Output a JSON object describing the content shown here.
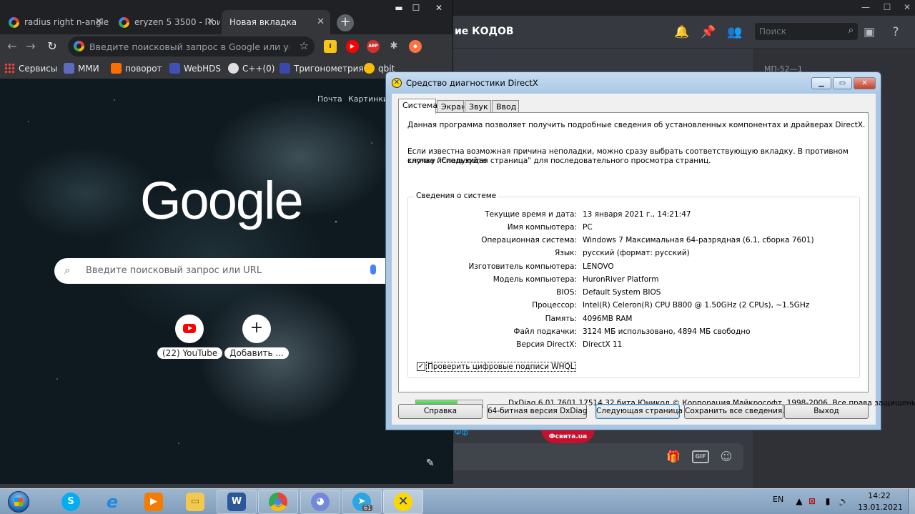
{
  "discord": {
    "channel_title": "ие КОДОВ",
    "search_placeholder": "Поиск",
    "member_group": "МП-52—1",
    "embed_text": "Фсвита.ua",
    "link_text": "Фф",
    "window_controls": [
      "—",
      "☐",
      "✕"
    ],
    "header_icons": [
      "bell-icon",
      "pin-icon",
      "members-icon",
      "inbox-icon",
      "help-icon"
    ],
    "input_icons": [
      "gift-icon",
      "gif-icon",
      "emoji-icon"
    ]
  },
  "chrome": {
    "tabs": [
      {
        "title": "radius right n-angle...",
        "active": false
      },
      {
        "title": "eryzen 5 3500 - Пои...",
        "active": false
      },
      {
        "title": "Новая вкладка",
        "active": true
      }
    ],
    "omnibox_placeholder": "Введите поисковый запрос в Google или ука...",
    "bookmarks": [
      {
        "label": "Сервисы",
        "color": "#ea4335"
      },
      {
        "label": "ММИ",
        "color": "#5c6bc0"
      },
      {
        "label": "поворот",
        "color": "#ff6d00"
      },
      {
        "label": "WebHDS",
        "color": "#3f51b5"
      },
      {
        "label": "C++(0)",
        "color": "#e0e0e0"
      },
      {
        "label": "Тригонометрия",
        "color": "#3949ab"
      },
      {
        "label": "qbit",
        "color": "#fbbc05"
      }
    ],
    "extensions": [
      {
        "name": "l-extension",
        "text": "l",
        "color": "#f5c518"
      },
      {
        "name": "youtube-extension",
        "text": "▶",
        "color": "#ff0000"
      },
      {
        "name": "adblock-extension",
        "text": "ABP",
        "color": "#d32f2f"
      },
      {
        "name": "puzzle-extension",
        "text": "✱",
        "color": "#5f6368"
      },
      {
        "name": "fox-extension",
        "text": "◆",
        "color": "#ff7043"
      }
    ],
    "top_links": [
      "Почта",
      "Картинки"
    ],
    "logo_text": "Google",
    "search_placeholder": "Введите поисковый запрос или URL",
    "shortcuts": [
      {
        "label": "(22) YouTube",
        "icon": "youtube-icon"
      },
      {
        "label": "Добавить ...",
        "icon": "plus-icon"
      }
    ]
  },
  "dxdiag": {
    "window_title": "Средство диагностики DirectX",
    "tabs": [
      "Система",
      "Экран",
      "Звук",
      "Ввод"
    ],
    "intro_1": "Данная программа позволяет получить подробные сведения об установленных компонентах и драйверах DirectX.",
    "intro_2a": "Если известна возможная причина неполадки, можно сразу выбрать соответствующую вкладку. В противном случае используйте",
    "intro_2b": "кнопку \"Следующая страница\" для последовательного просмотра страниц.",
    "group_title": "Сведения о системе",
    "rows": [
      {
        "label": "Текущие время и дата:",
        "value": "13 января 2021 г., 14:21:47"
      },
      {
        "label": "Имя компьютера:",
        "value": "PC"
      },
      {
        "label": "Операционная система:",
        "value": "Windows 7 Максимальная 64-разрядная (6.1, сборка 7601)"
      },
      {
        "label": "Язык:",
        "value": "русский (формат: русский)"
      },
      {
        "label": "Изготовитель компьютера:",
        "value": "LENOVO"
      },
      {
        "label": "Модель компьютера:",
        "value": "HuronRiver Platform"
      },
      {
        "label": "BIOS:",
        "value": "Default System BIOS"
      },
      {
        "label": "Процессор:",
        "value": "Intel(R) Celeron(R) CPU B800 @ 1.50GHz (2 CPUs), ~1.5GHz"
      },
      {
        "label": "Память:",
        "value": "4096MB RAM"
      },
      {
        "label": "Файл подкачки:",
        "value": "3124 МБ использовано, 4894 МБ свободно"
      },
      {
        "label": "Версия DirectX:",
        "value": "DirectX 11"
      }
    ],
    "whql_label": "Проверить цифровые подписи WHQL",
    "whql_checked": true,
    "progress_fraction": 0.62,
    "copyright": "DxDiag 6.01.7601.17514 32 бита Юникод  © Корпорация Майкрософт, 1998-2006.  Все права защищены.",
    "buttons": {
      "help": "Справка",
      "dxdiag64": "64-битная версия DxDiag",
      "next": "Следующая страница",
      "save": "Сохранить все сведения...",
      "exit": "Выход"
    }
  },
  "taskbar": {
    "apps": [
      {
        "name": "skype-taskbar",
        "text": "S",
        "color": "#00aff0"
      },
      {
        "name": "ie-taskbar",
        "text": "e",
        "color": "#1e88e5"
      },
      {
        "name": "media-player-taskbar",
        "text": "▶",
        "color": "#f57c00"
      },
      {
        "name": "explorer-taskbar",
        "text": "▭",
        "color": "#f2c94c"
      },
      {
        "name": "word-taskbar",
        "text": "W",
        "color": "#2b579a"
      },
      {
        "name": "chrome-taskbar",
        "text": "◉",
        "color": "#34a853"
      },
      {
        "name": "discord-taskbar",
        "text": "◕",
        "color": "#7289da"
      },
      {
        "name": "telegram-taskbar",
        "text": "➤",
        "color": "#2ca5e0"
      },
      {
        "name": "dxdiag-taskbar",
        "text": "✕",
        "color": "#ffd700"
      }
    ],
    "telegram_badge": "61",
    "lang": "EN",
    "time": "14:22",
    "date": "13.01.2021"
  }
}
